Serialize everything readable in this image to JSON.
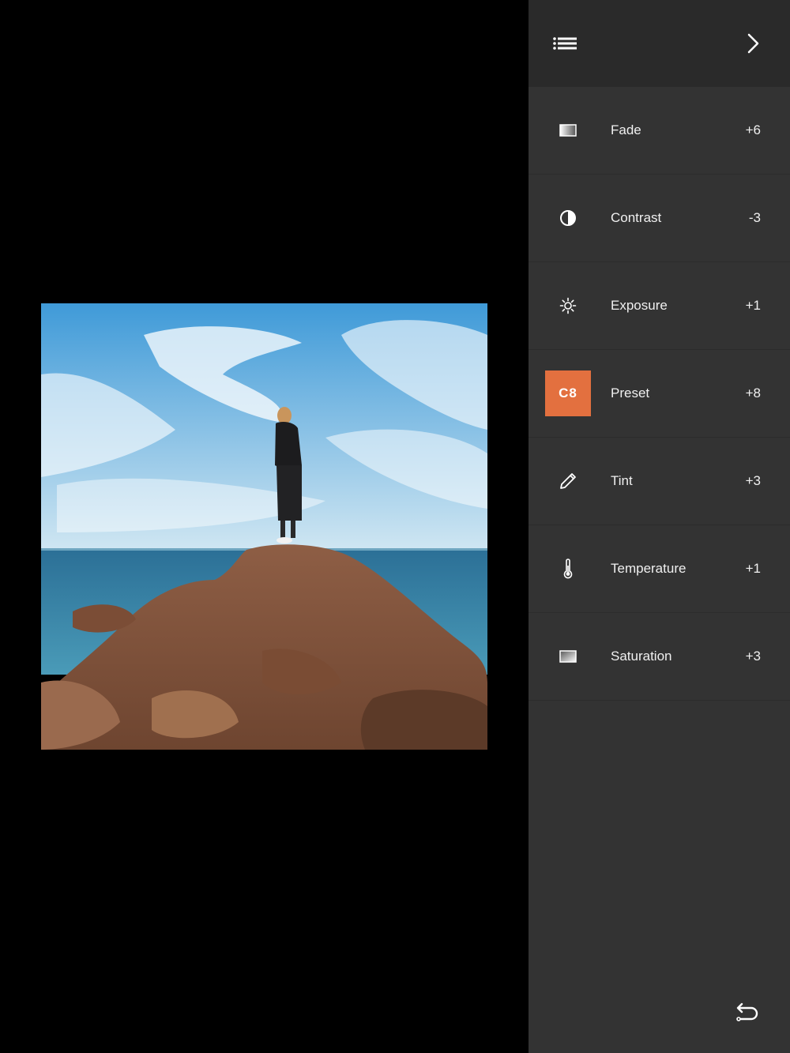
{
  "photo": {
    "subject": "",
    "colors": {
      "sky_top": "#3f9ad8",
      "sky_bottom": "#bfe0f0",
      "sea": "#2f7ea2",
      "rock": "#8b5a40",
      "rock_dark": "#5c3a28"
    }
  },
  "header": {
    "menu_icon": "list-icon",
    "next_icon": "chevron-right-icon"
  },
  "adjustments": [
    {
      "label": "Fade",
      "value": "+6",
      "icon": "fade-icon"
    },
    {
      "label": "Contrast",
      "value": "-3",
      "icon": "contrast-icon"
    },
    {
      "label": "Exposure",
      "value": "+1",
      "icon": "sun-icon"
    },
    {
      "label": "Preset",
      "value": "+8",
      "icon": "preset-badge",
      "badge_text": "C8",
      "badge_color": "#e3703f"
    },
    {
      "label": "Tint",
      "value": "+3",
      "icon": "pencil-icon"
    },
    {
      "label": "Temperature",
      "value": "+1",
      "icon": "thermometer-icon"
    },
    {
      "label": "Saturation",
      "value": "+3",
      "icon": "saturation-icon"
    }
  ],
  "footer": {
    "undo_icon": "undo-icon"
  },
  "theme": {
    "panel_bg": "#333333",
    "header_bg": "#2a2a2a",
    "accent": "#e3703f",
    "text": "#f0f0f0"
  }
}
